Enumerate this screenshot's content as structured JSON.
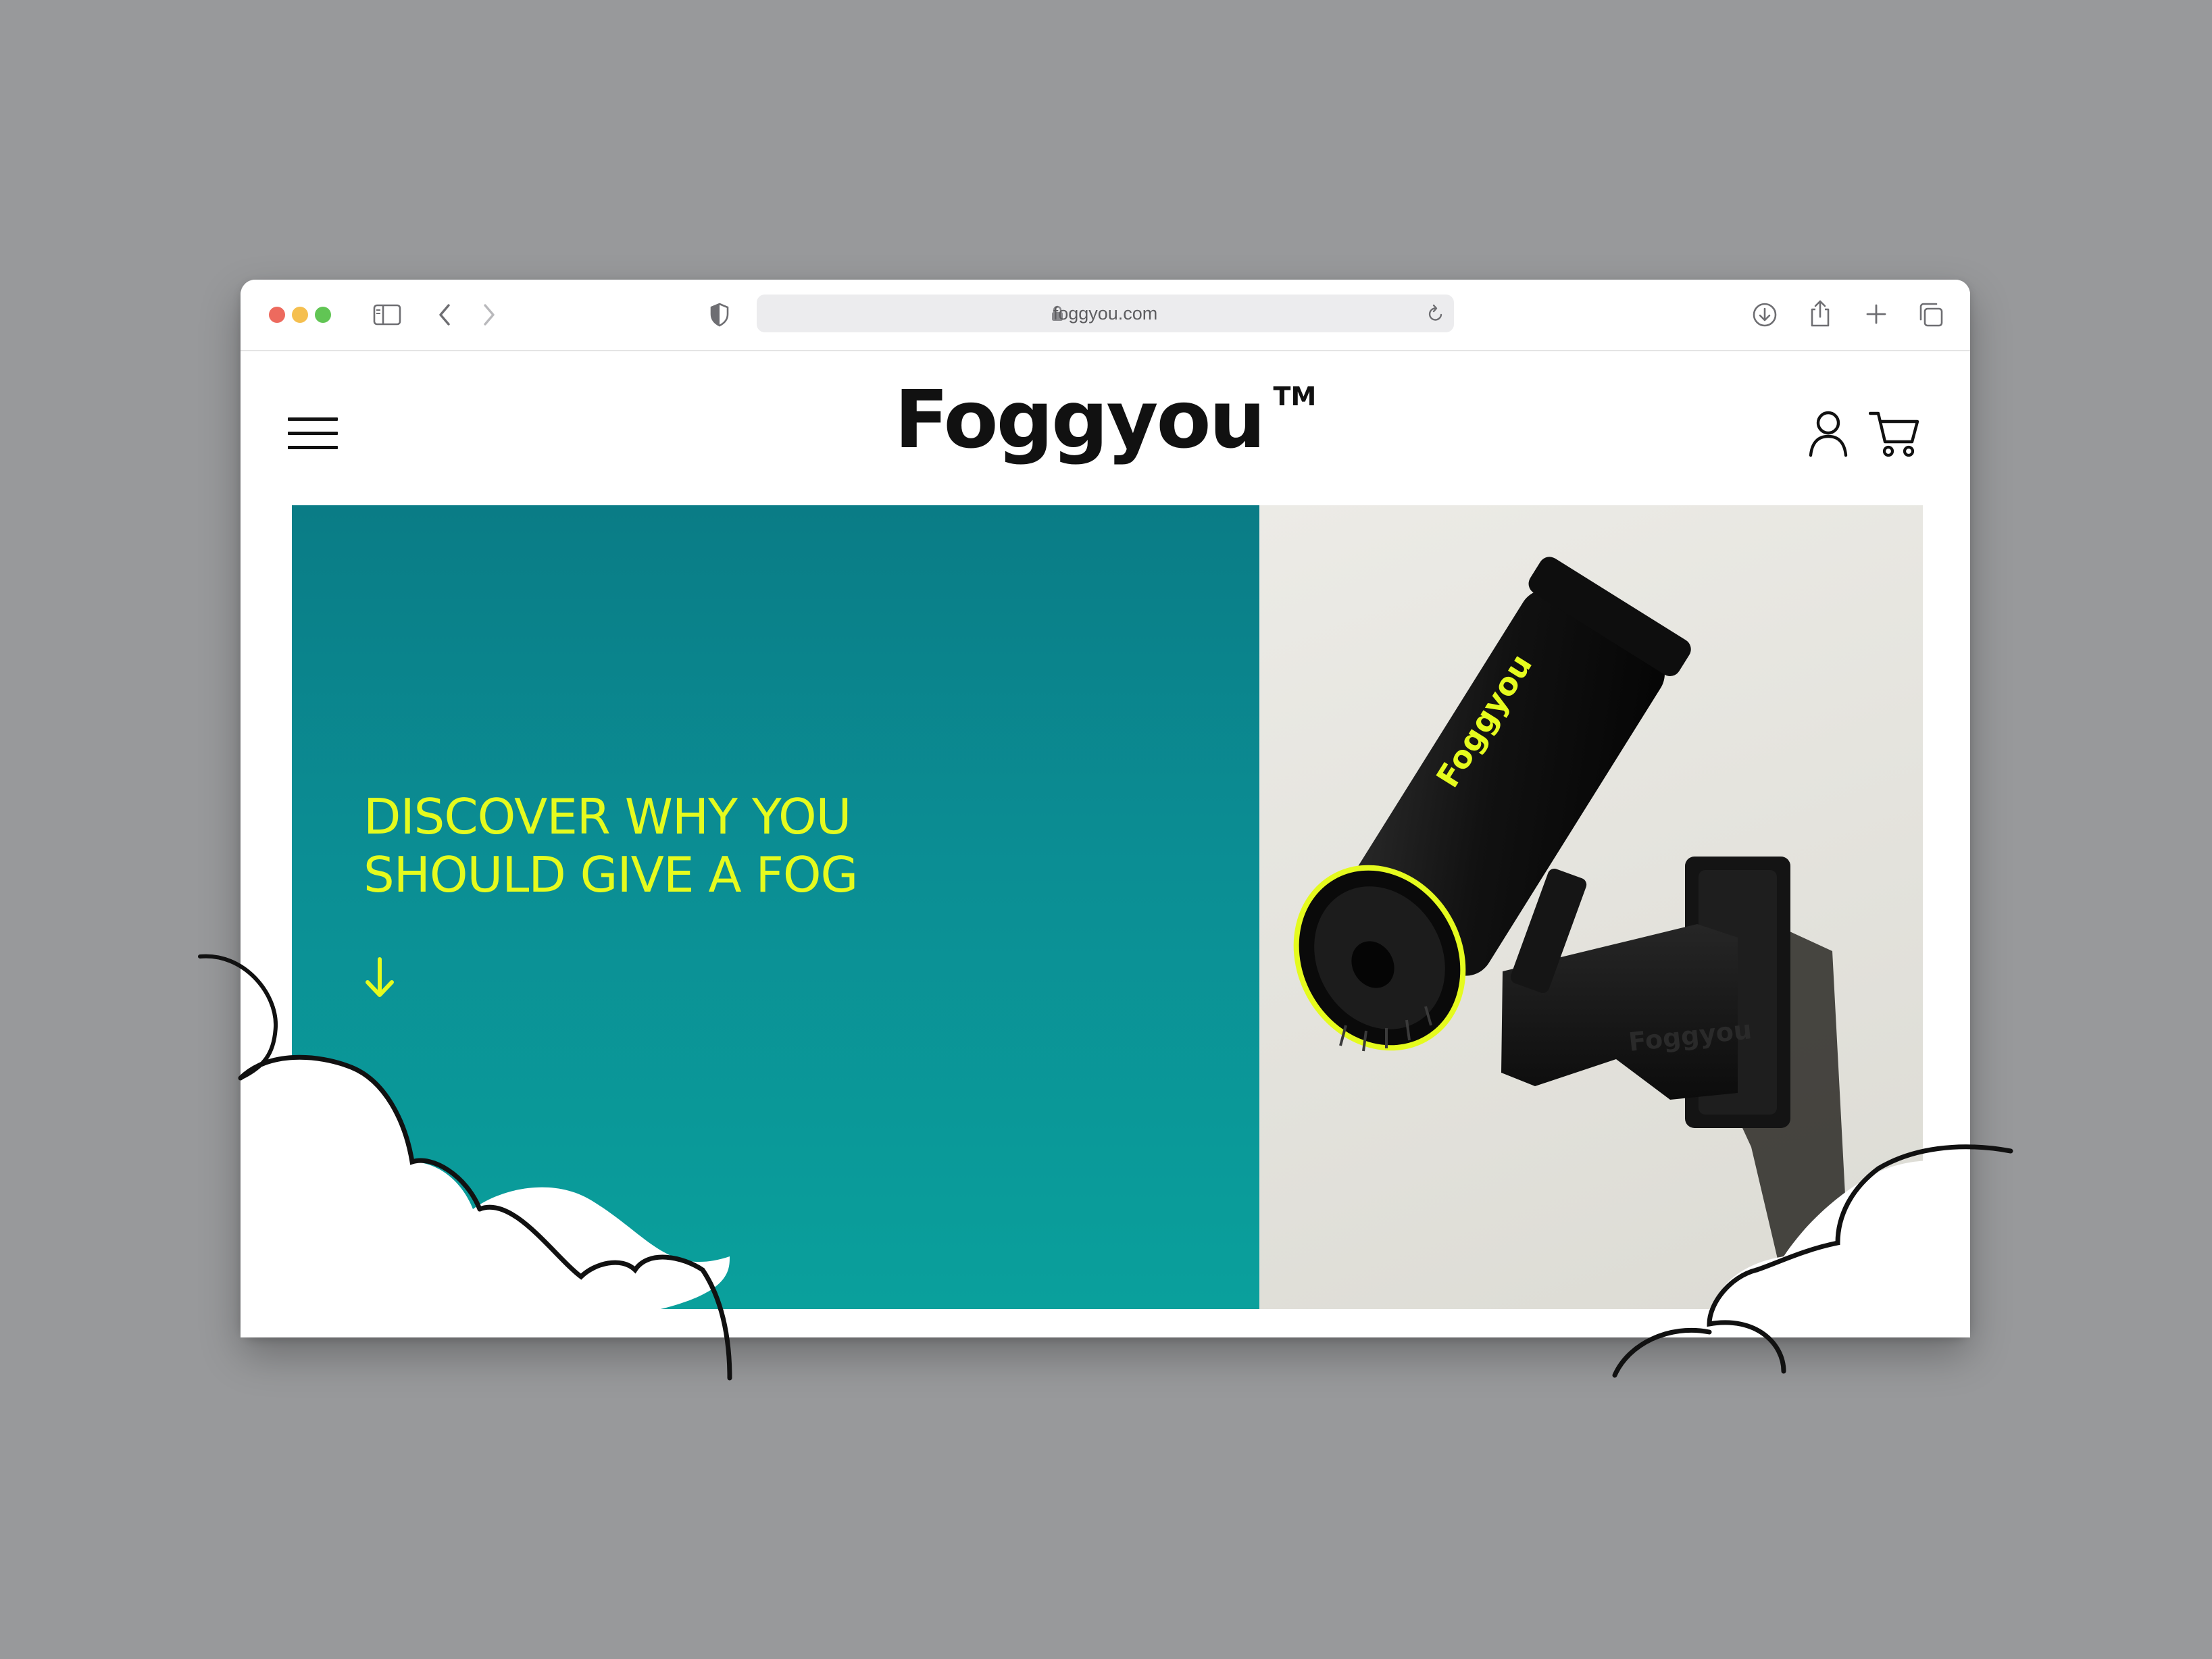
{
  "browser": {
    "url": "foggyou.com",
    "traffic_lights": [
      "#ed6a5e",
      "#f5bf4f",
      "#61c554"
    ]
  },
  "header": {
    "logo_text": "Foggyou",
    "logo_tm": "TM"
  },
  "hero": {
    "headline_line1": "DISCOVER WHY YOU",
    "headline_line2": "SHOULD GIVE A FOG",
    "accent_color": "#e5fb1e",
    "teal_color": "#0b8e94",
    "camera_label": "Foggyou",
    "mount_label": "Foggyou"
  },
  "colors": {
    "page_background": "#98999b",
    "text_dark": "#111111"
  }
}
